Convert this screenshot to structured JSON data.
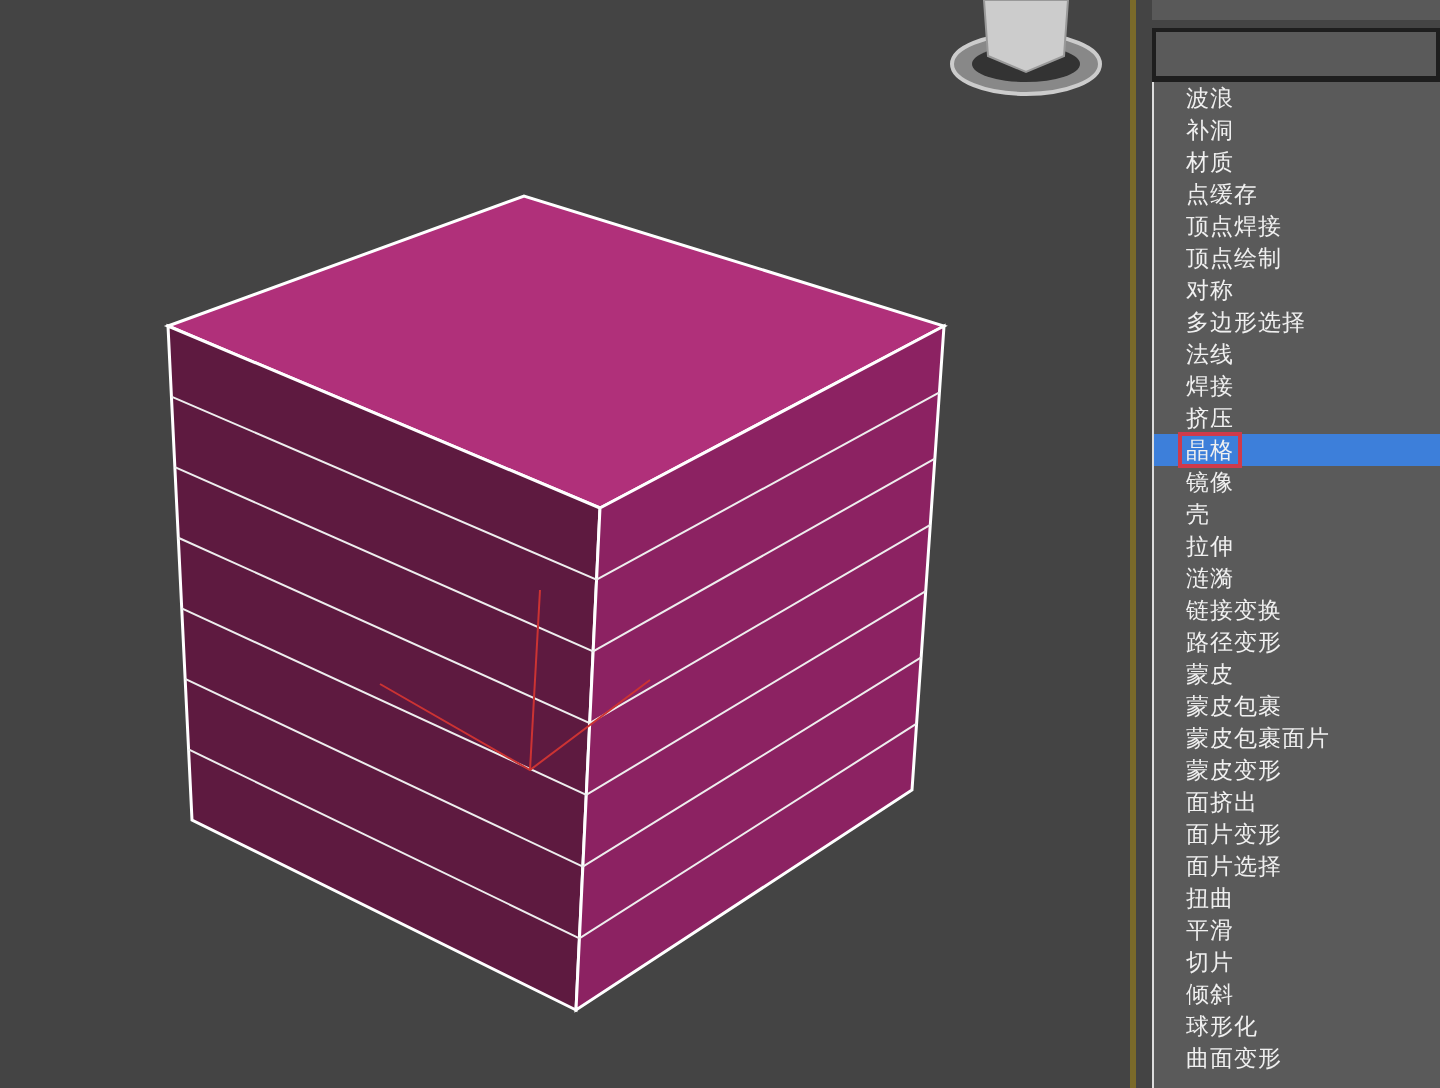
{
  "modifier_list": [
    {
      "label": "波浪",
      "selected": false
    },
    {
      "label": "补洞",
      "selected": false
    },
    {
      "label": "材质",
      "selected": false
    },
    {
      "label": "点缓存",
      "selected": false
    },
    {
      "label": "顶点焊接",
      "selected": false
    },
    {
      "label": "顶点绘制",
      "selected": false
    },
    {
      "label": "对称",
      "selected": false
    },
    {
      "label": "多边形选择",
      "selected": false
    },
    {
      "label": "法线",
      "selected": false
    },
    {
      "label": "焊接",
      "selected": false
    },
    {
      "label": "挤压",
      "selected": false
    },
    {
      "label": "晶格",
      "selected": true
    },
    {
      "label": "镜像",
      "selected": false
    },
    {
      "label": "壳",
      "selected": false
    },
    {
      "label": "拉伸",
      "selected": false
    },
    {
      "label": "涟漪",
      "selected": false
    },
    {
      "label": "链接变换",
      "selected": false
    },
    {
      "label": "路径变形",
      "selected": false
    },
    {
      "label": "蒙皮",
      "selected": false
    },
    {
      "label": "蒙皮包裹",
      "selected": false
    },
    {
      "label": "蒙皮包裹面片",
      "selected": false
    },
    {
      "label": "蒙皮变形",
      "selected": false
    },
    {
      "label": "面挤出",
      "selected": false
    },
    {
      "label": "面片变形",
      "selected": false
    },
    {
      "label": "面片选择",
      "selected": false
    },
    {
      "label": "扭曲",
      "selected": false
    },
    {
      "label": "平滑",
      "selected": false
    },
    {
      "label": "切片",
      "selected": false
    },
    {
      "label": "倾斜",
      "selected": false
    },
    {
      "label": "球形化",
      "selected": false
    },
    {
      "label": "曲面变形",
      "selected": false
    }
  ]
}
